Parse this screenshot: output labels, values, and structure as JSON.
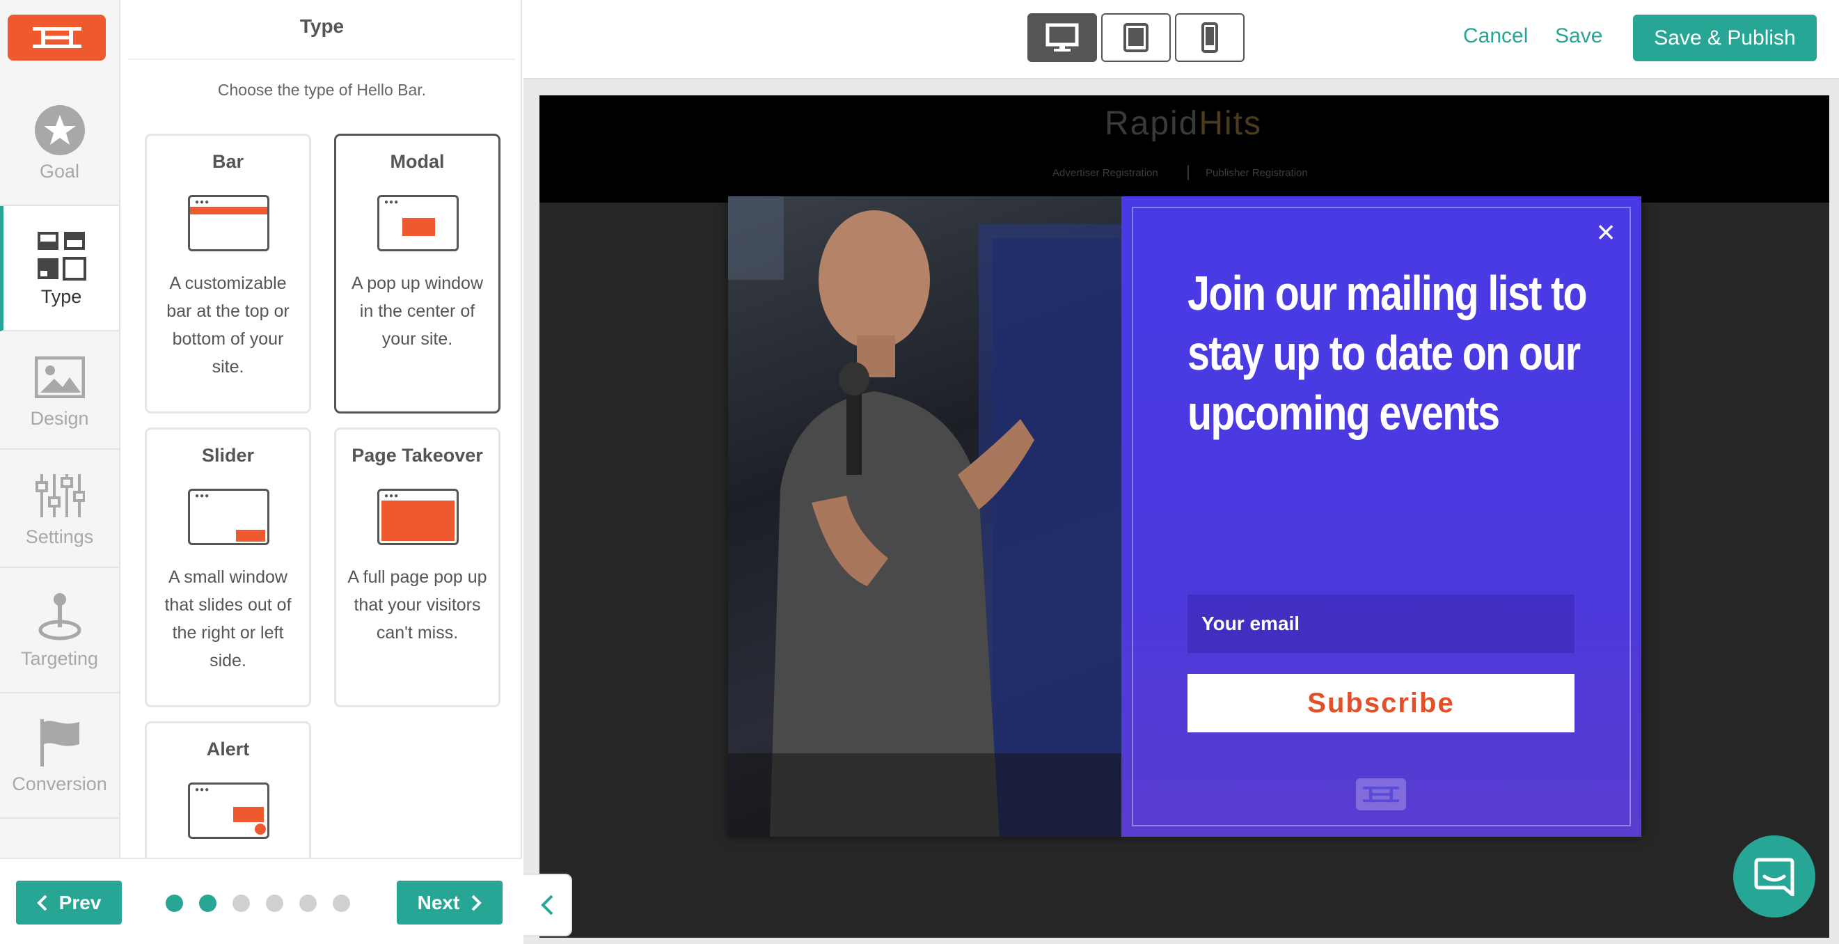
{
  "nav": {
    "items": [
      {
        "label": "Goal",
        "icon": "star-icon"
      },
      {
        "label": "Type",
        "icon": "layout-icon"
      },
      {
        "label": "Design",
        "icon": "image-icon"
      },
      {
        "label": "Settings",
        "icon": "sliders-icon"
      },
      {
        "label": "Targeting",
        "icon": "joystick-icon"
      },
      {
        "label": "Conversion",
        "icon": "flag-icon"
      }
    ],
    "active": "Type"
  },
  "panel": {
    "title": "Type",
    "subtitle": "Choose the type of Hello Bar.",
    "cards": [
      {
        "title": "Bar",
        "desc": "A customizable bar at the top or bottom of your site."
      },
      {
        "title": "Modal",
        "desc": "A pop up window in the center of your site.",
        "selected": true
      },
      {
        "title": "Slider",
        "desc": "A small window that slides out of the right or left side."
      },
      {
        "title": "Page Takeover",
        "desc": "A full page pop up that your visitors can't miss."
      },
      {
        "title": "Alert",
        "desc": ""
      }
    ]
  },
  "footer": {
    "prev_label": "Prev",
    "next_label": "Next",
    "steps_total": 6,
    "current_step": 2
  },
  "topbar": {
    "devices": [
      "desktop-icon",
      "tablet-icon",
      "mobile-icon"
    ],
    "active_device": "desktop",
    "cancel_label": "Cancel",
    "save_label": "Save",
    "publish_label": "Save & Publish"
  },
  "site": {
    "logo_a": "Rapid",
    "logo_b": "Hits",
    "links": [
      "Advertiser Registration",
      "Publisher Registration"
    ]
  },
  "modal": {
    "headline": "Join our mailing list to stay up to date on our upcoming events",
    "email_placeholder": "Your email",
    "subscribe_label": "Subscribe",
    "close_symbol": "×"
  },
  "colors": {
    "brand_orange": "#ee5a2e",
    "accent_teal": "#27a595",
    "modal_purple": "#4a3ae6"
  }
}
